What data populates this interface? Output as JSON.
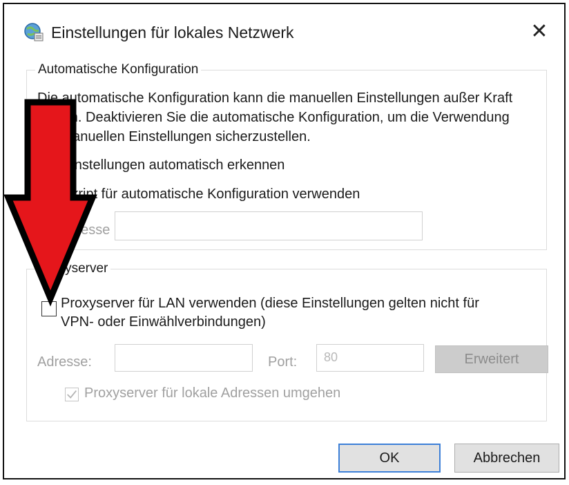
{
  "window": {
    "title": "Einstellungen für lokales Netzwerk",
    "close_glyph": "✕"
  },
  "auto_config": {
    "legend": "Automatische Konfiguration",
    "description": [
      "Die automatische Konfiguration kann die manuellen Einstellungen außer Kraft",
      "setzen. Deaktivieren Sie die automatische Konfiguration, um die Verwendung",
      "der manuellen Einstellungen sicherzustellen."
    ],
    "auto_detect_label": "Einstellungen automatisch erkennen",
    "script_label": "Skript für automatische Konfiguration verwenden",
    "address_label": "Adresse",
    "address_value": ""
  },
  "proxy": {
    "legend": "Proxyserver",
    "use_proxy_label_line1": "Proxyserver für LAN verwenden (diese Einstellungen gelten nicht für",
    "use_proxy_label_line2": "VPN- oder Einwählverbindungen)",
    "use_proxy_checked": false,
    "address_label": "Adresse:",
    "address_value": "",
    "port_label": "Port:",
    "port_value": "80",
    "advanced_button": "Erweitert",
    "bypass_label": "Proxyserver für lokale Adressen umgehen",
    "bypass_checked": true
  },
  "buttons": {
    "ok": "OK",
    "cancel": "Abbrechen"
  },
  "annotation": {
    "color": "#e5161b",
    "outline": "#000000",
    "icon": "arrow-down-icon"
  },
  "icons": {
    "app": "network-settings-icon",
    "close": "close-icon",
    "check": "checkmark-icon"
  }
}
